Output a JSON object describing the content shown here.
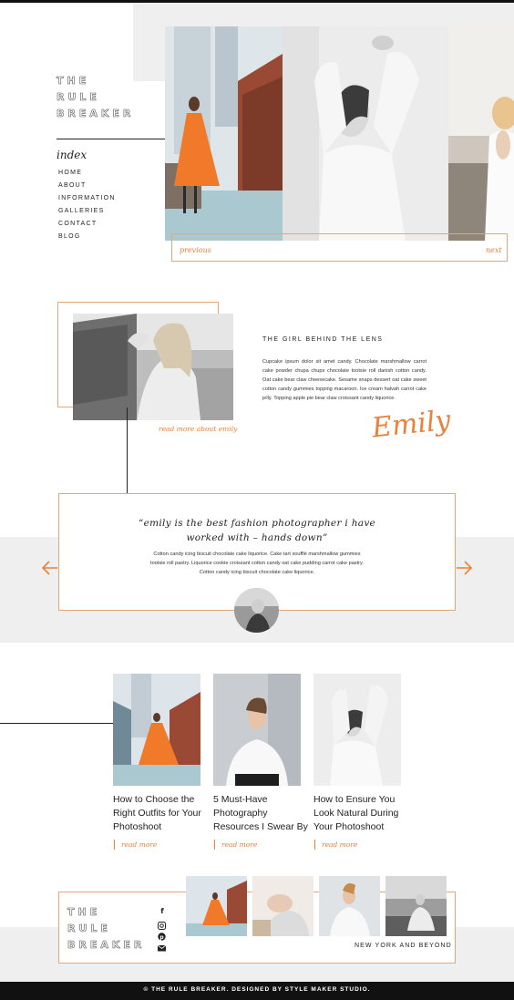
{
  "brand": {
    "line1": "THE",
    "line2": "RULE",
    "line3": "BREAKER"
  },
  "nav": {
    "heading": "index",
    "items": [
      "HOME",
      "ABOUT",
      "INFORMATION",
      "GALLERIES",
      "CONTACT",
      "BLOG"
    ]
  },
  "slider": {
    "previous": "previous",
    "next": "next"
  },
  "about": {
    "heading": "THE GIRL BEHIND THE LENS",
    "body": "Cupcake ipsum dolor sit amet candy. Chocolate marshmallow carrot cake powder chupa chups chocolate tootsie roll danish cotton candy. Oat cake bear claw cheesecake. Sesame snaps dessert oat cake sweet cotton candy gummies topping macaroon. Ice cream halvah carrot cake jelly. Topping apple pie bear claw croissant candy liquorice.",
    "read_more": "read more about emily",
    "signature": "Emily"
  },
  "testimonial": {
    "quote_line1": "“emily is the best fashion photographer i have",
    "quote_line2": "worked with – hands down”",
    "body_line1": "Cotton candy icing biscuit chocolate cake liquorice. Cake tart soufflé marshmallow gummies",
    "body_line2": "tootsie roll pastry. Liquorice cookie croissant cotton candy oat cake pudding carrot cake pastry.",
    "body_line3": "Cotton candy icing biscuit chocolate cake liquorice."
  },
  "posts": [
    {
      "title_l1": "How to Choose the",
      "title_l2": "Right Outfits for Your",
      "title_l3": "Photoshoot",
      "read_more": "read more"
    },
    {
      "title_l1": "5 Must-Have",
      "title_l2": "Photography",
      "title_l3": "Resources I Swear By",
      "read_more": "read more"
    },
    {
      "title_l1": "How to Ensure You",
      "title_l2": "Look Natural During",
      "title_l3": "Your Photoshoot",
      "read_more": "read more"
    }
  ],
  "footer": {
    "tagline": "NEW YORK AND BEYOND",
    "social_icons": [
      "facebook-icon",
      "instagram-icon",
      "pinterest-icon",
      "email-icon"
    ],
    "copyright": "© THE RULE BREAKER. DESIGNED BY STYLE MAKER STUDIO."
  },
  "colors": {
    "accent": "#e8813a",
    "light_gray": "#efefef",
    "dark": "#111111"
  }
}
